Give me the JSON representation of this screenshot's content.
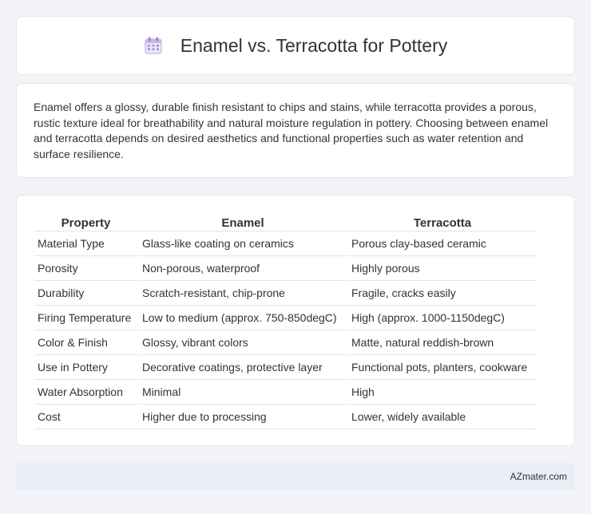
{
  "header": {
    "title": "Enamel vs. Terracotta for Pottery",
    "icon": "calendar-icon"
  },
  "intro": {
    "text": "Enamel offers a glossy, durable finish resistant to chips and stains, while terracotta provides a porous, rustic texture ideal for breathability and natural moisture regulation in pottery. Choosing between enamel and terracotta depends on desired aesthetics and functional properties such as water retention and surface resilience."
  },
  "table": {
    "headers": [
      "Property",
      "Enamel",
      "Terracotta"
    ],
    "rows": [
      [
        "Material Type",
        "Glass-like coating on ceramics",
        "Porous clay-based ceramic"
      ],
      [
        "Porosity",
        "Non-porous, waterproof",
        "Highly porous"
      ],
      [
        "Durability",
        "Scratch-resistant, chip-prone",
        "Fragile, cracks easily"
      ],
      [
        "Firing Temperature",
        "Low to medium (approx. 750-850degC)",
        "High (approx. 1000-1150degC)"
      ],
      [
        "Color & Finish",
        "Glossy, vibrant colors",
        "Matte, natural reddish-brown"
      ],
      [
        "Use in Pottery",
        "Decorative coatings, protective layer",
        "Functional pots, planters, cookware"
      ],
      [
        "Water Absorption",
        "Minimal",
        "High"
      ],
      [
        "Cost",
        "Higher due to processing",
        "Lower, widely available"
      ]
    ]
  },
  "footer": {
    "brand": "AZmater.com"
  },
  "colors": {
    "background": "#f2f4f8",
    "card": "#ffffff",
    "footer_bg": "#e9eef7",
    "icon_accent": "#a78bda"
  }
}
